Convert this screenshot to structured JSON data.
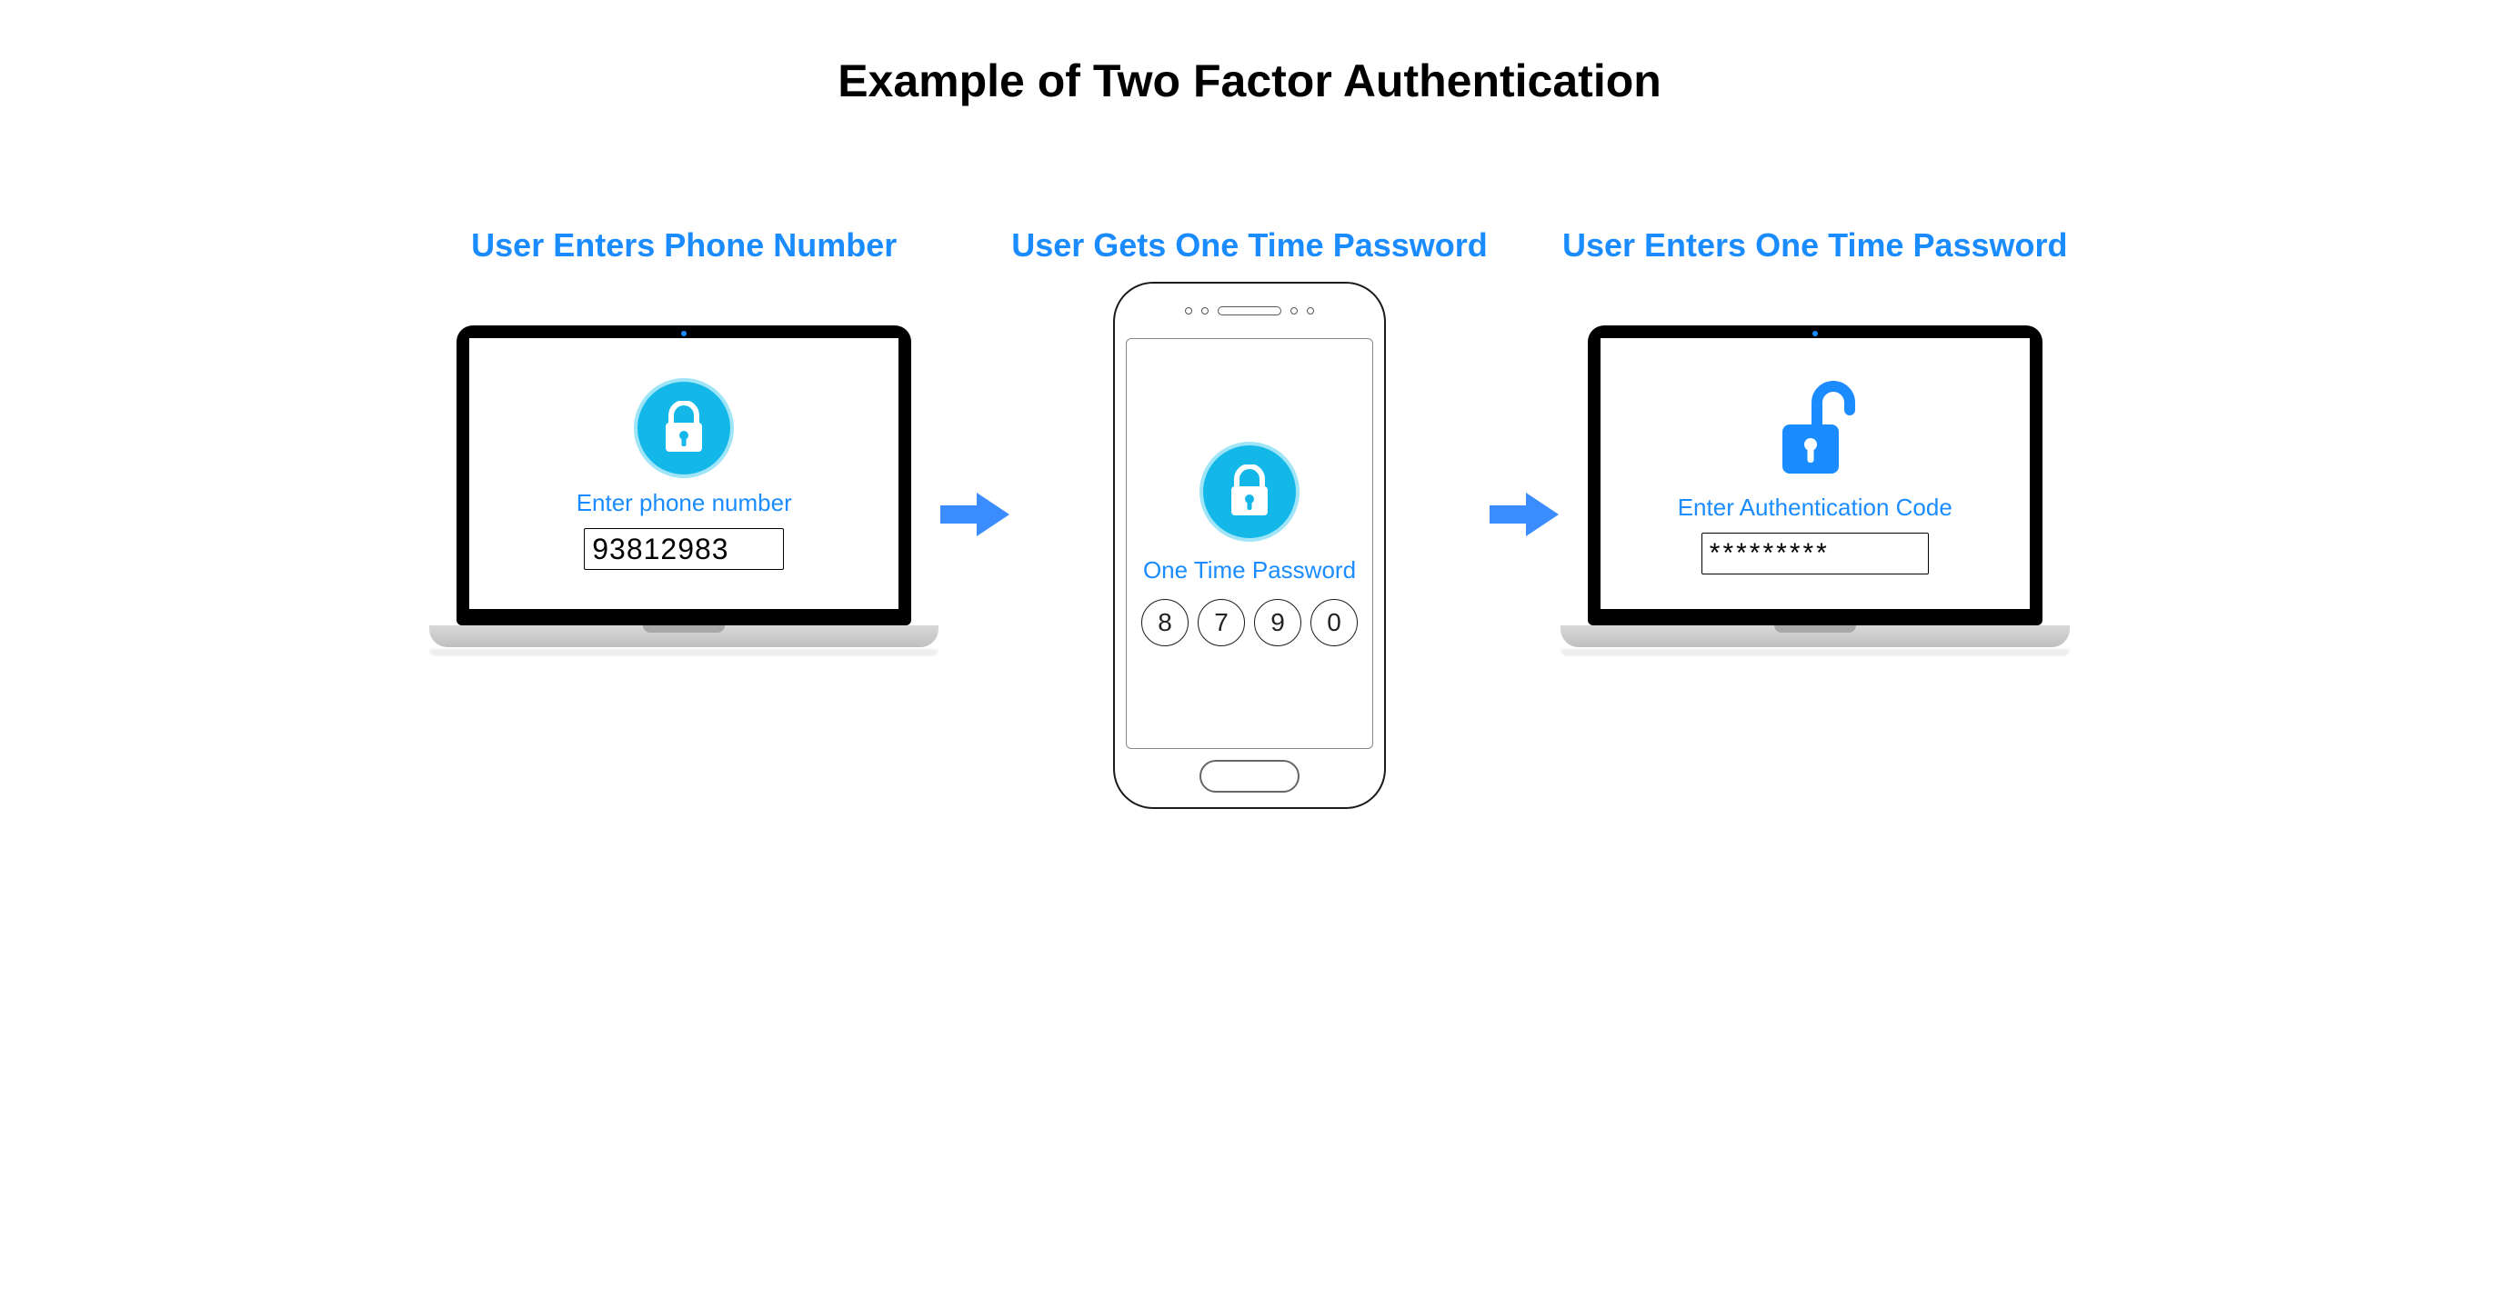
{
  "title": "Example of Two Factor Authentication",
  "colors": {
    "accent_blue": "#1a8cff",
    "lock_cyan": "#13b8e8",
    "arrow_blue": "#3a8cff"
  },
  "steps": {
    "step1": {
      "label": "User Enters  Phone Number",
      "caption": "Enter phone number",
      "value": "93812983"
    },
    "step2": {
      "label": "User Gets One Time Password",
      "caption": "One Time Password",
      "otp": [
        "8",
        "7",
        "9",
        "0"
      ]
    },
    "step3": {
      "label": "User Enters One Time Password",
      "caption": "Enter Authentication Code",
      "value": "*********"
    }
  }
}
